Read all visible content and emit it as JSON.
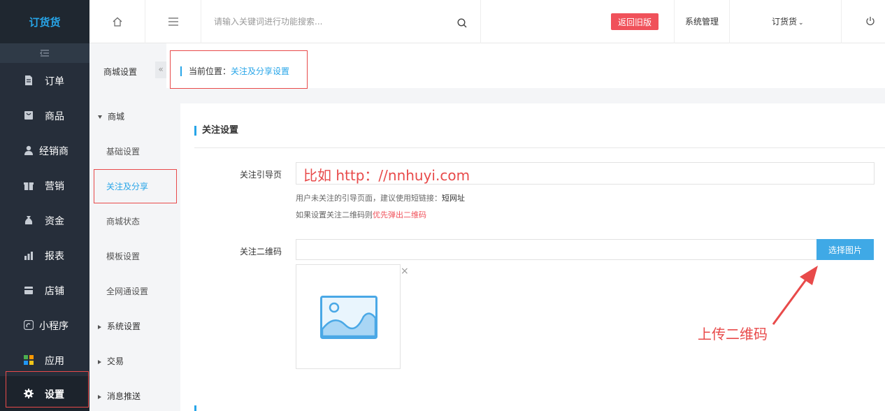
{
  "app": {
    "logo": "订货货"
  },
  "nav": {
    "items": [
      {
        "label": "订单",
        "icon": "document-icon"
      },
      {
        "label": "商品",
        "icon": "bag-icon"
      },
      {
        "label": "经销商",
        "icon": "user-icon"
      },
      {
        "label": "营销",
        "icon": "gift-icon"
      },
      {
        "label": "资金",
        "icon": "money-bag-icon"
      },
      {
        "label": "报表",
        "icon": "bar-chart-icon"
      },
      {
        "label": "店铺",
        "icon": "store-icon"
      },
      {
        "label": "小程序",
        "icon": "mini-program-icon"
      },
      {
        "label": "应用",
        "icon": "apps-icon"
      },
      {
        "label": "设置",
        "icon": "gear-icon"
      }
    ]
  },
  "header": {
    "search_placeholder": "请输入关键词进行功能搜索...",
    "old_version": "返回旧版",
    "system_manage": "系统管理",
    "account": "订货货"
  },
  "subnav": {
    "title": "商城设置",
    "group_mall": "商城",
    "items": [
      "基础设置",
      "关注及分享",
      "商城状态",
      "模板设置",
      "全网通设置"
    ],
    "groups": [
      "系统设置",
      "交易",
      "消息推送"
    ]
  },
  "breadcrumb": {
    "prefix": "当前位置：",
    "current": "关注及分享设置"
  },
  "section": {
    "title": "关注设置",
    "guide_label": "关注引导页",
    "guide_value": "比如 http：//nnhuyi.com",
    "hint1_prefix": "用户未关注的引导页面，建议使用短链接：",
    "hint1_strong": "短网址",
    "hint2_prefix": "如果设置关注二维码则",
    "hint2_red": "优先弹出二维码",
    "qr_label": "关注二维码",
    "choose_button": "选择图片",
    "close": "×"
  },
  "annotation": {
    "upload_text": "上传二维码"
  },
  "colors": {
    "accent": "#27a5e8",
    "sidebar": "#262e3a",
    "danger": "#f0515a",
    "annotation": "#e84a4a"
  }
}
